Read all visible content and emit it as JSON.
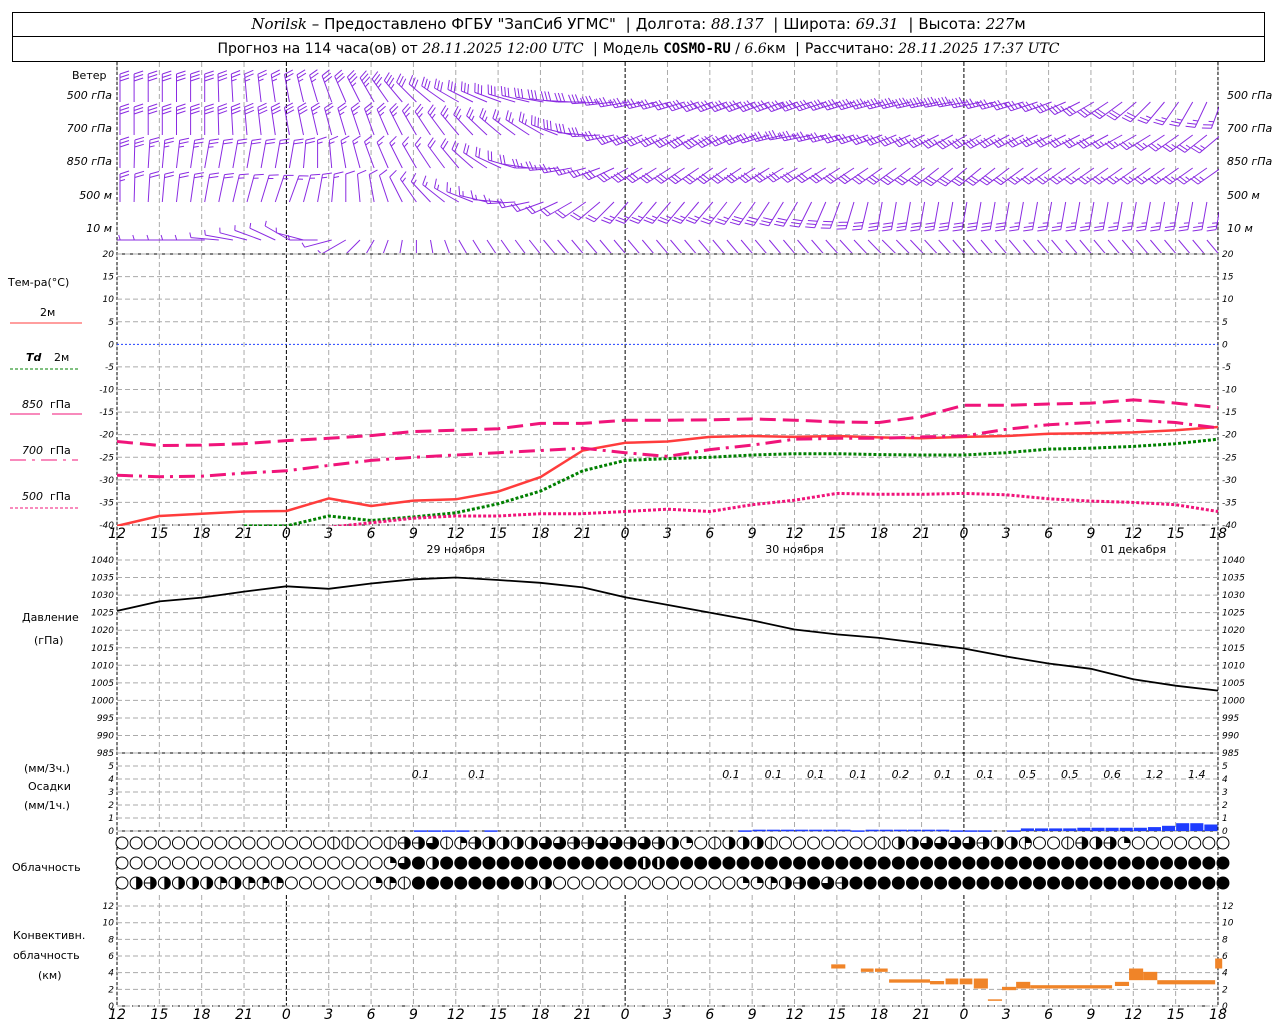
{
  "header": {
    "station": "Norilsk",
    "provider": " – Предоставлено ФГБУ \"ЗапСиб УГМС\"",
    "lon_label": "Долгота: ",
    "lon": "88.137",
    "lat_label": "Широта: ",
    "lat": "69.31",
    "alt_label": "Высота: ",
    "alt": "227",
    "alt_unit": "м",
    "forecast_label": "Прогноз на 114 часа(ов) от ",
    "forecast_time": "28.11.2025 12:00 UTC",
    "model_label": "Модель ",
    "model": "COSMO-RU",
    "model_sep": " / ",
    "resolution": "6.6",
    "resolution_unit": "км",
    "calc_label": "Рассчитано: ",
    "calc_time": "28.11.2025 17:37 UTC",
    "sep": "|"
  },
  "colors": {
    "t2m": "#ff3c3c",
    "td2m": "#008000",
    "upper": "#f0147a",
    "wind": "#8a2be2",
    "precip": "#1e3cff",
    "convective": "#f08428",
    "zero_line": "#2040ff"
  },
  "labels": {
    "wind": "Ветер",
    "temp": "Тем-ра(°C)",
    "t2m": "2м",
    "td": "Td",
    "td2m": "2м",
    "t850": "850",
    "t700": "700",
    "t500": "500",
    "hpa": "гПа",
    "pressure": "Давление",
    "pressure_unit": "(гПа)",
    "precip3": "(мм/3ч.)",
    "precip": "Осадки",
    "precip1": "(мм/1ч.)",
    "cloud": "Облачность",
    "conv1": "Конвективн.",
    "conv2": "облачность",
    "conv3": "(км)"
  },
  "x_tick_labels": [
    "12",
    "15",
    "18",
    "21",
    "0",
    "3",
    "6",
    "9",
    "12",
    "15",
    "18",
    "21",
    "0",
    "3",
    "6",
    "9",
    "12",
    "15",
    "18",
    "21",
    "0",
    "3",
    "6",
    "9",
    "12",
    "15",
    "18"
  ],
  "date_labels": [
    {
      "text": "29 ноября",
      "time": "29.11 12:00"
    },
    {
      "text": "30 ноября",
      "time": "30.11 12:00"
    },
    {
      "text": "01 декабря",
      "time": "01.12 12:00"
    }
  ],
  "series_start": "28.11 12:00",
  "wind": {
    "step_hours": 6,
    "levels": [
      {
        "label": "500 гПа",
        "dir": [
          0,
          0,
          350,
          330,
          300,
          280,
          260,
          250,
          250,
          255,
          260,
          250,
          230,
          200
        ],
        "speed_ms": [
          15,
          15,
          12,
          18,
          15,
          15,
          18,
          20,
          22,
          20,
          20,
          18,
          15,
          12
        ]
      },
      {
        "label": "700 гПа",
        "dir": [
          0,
          0,
          350,
          340,
          320,
          300,
          250,
          240,
          260,
          250,
          240,
          245,
          240,
          230
        ],
        "speed_ms": [
          15,
          15,
          15,
          12,
          12,
          14,
          18,
          20,
          18,
          17,
          18,
          16,
          14,
          12
        ]
      },
      {
        "label": "850 гПа",
        "dir": [
          0,
          10,
          10,
          340,
          320,
          270,
          240,
          235,
          240,
          235,
          230,
          235,
          235,
          235
        ],
        "speed_ms": [
          15,
          12,
          10,
          8,
          10,
          12,
          15,
          16,
          15,
          15,
          15,
          14,
          12,
          12
        ]
      },
      {
        "label": "500  м",
        "dir": [
          0,
          10,
          20,
          350,
          300,
          250,
          220,
          220,
          210,
          190,
          190,
          190,
          190,
          190
        ],
        "speed_ms": [
          12,
          10,
          8,
          6,
          8,
          10,
          12,
          14,
          15,
          15,
          15,
          14,
          14,
          14
        ]
      },
      {
        "label": "10   м",
        "dir": [
          270,
          270,
          300,
          210,
          150,
          140,
          140,
          140,
          140,
          135,
          140,
          140,
          140,
          140
        ],
        "speed_ms": [
          3,
          3,
          2,
          2,
          3,
          3,
          3,
          4,
          4,
          4,
          4,
          4,
          4,
          4
        ]
      }
    ]
  },
  "chart_data": [
    {
      "type": "line",
      "ylabel": "Тем-ра(°C)",
      "ylim": [
        -40,
        20
      ],
      "y_ticks": [
        20,
        15,
        10,
        5,
        0,
        -5,
        -10,
        -15,
        -20,
        -25,
        -30,
        -35,
        -40
      ],
      "step_hours": 3,
      "series": [
        {
          "name": "2м",
          "key": "t2m",
          "values": [
            -40.2,
            -38,
            -37.5,
            -37,
            -36.9,
            -34.1,
            -35.8,
            -34.6,
            -34.3,
            -32.6,
            -29.4,
            -23.5,
            -21.8,
            -21.5,
            -20.5,
            -20.3,
            -20.5,
            -20.3,
            -20.6,
            -20.8,
            -20.5,
            -20.3,
            -19.8,
            -19.7,
            -19.5,
            -19,
            -18.3
          ]
        },
        {
          "name": "Td 2м",
          "key": "td2m",
          "values": [
            null,
            null,
            null,
            -40.2,
            -40.2,
            -38,
            -39,
            -38.2,
            -37.3,
            -35.3,
            -32.5,
            -28,
            -25.7,
            -25.3,
            -25,
            -24.5,
            -24.2,
            -24.2,
            -24.4,
            -24.5,
            -24.5,
            -24,
            -23.2,
            -23,
            -22.6,
            -22,
            -21
          ]
        },
        {
          "name": "850 гПа",
          "key": "t850",
          "values": [
            -21.5,
            -22.4,
            -22.3,
            -22,
            -21.3,
            -20.8,
            -20.2,
            -19.3,
            -19,
            -18.7,
            -17.5,
            -17.5,
            -16.8,
            -16.8,
            -16.7,
            -16.5,
            -16.8,
            -17.2,
            -17.3,
            -16,
            -13.5,
            -13.5,
            -13.2,
            -13,
            -12.3,
            -13,
            -14
          ]
        },
        {
          "name": "700 гПа",
          "key": "t700",
          "values": [
            -29,
            -29.3,
            -29.2,
            -28.5,
            -28,
            -26.8,
            -25.7,
            -25,
            -24.5,
            -24,
            -23.5,
            -23,
            -24,
            -24.8,
            -23.3,
            -22.3,
            -21,
            -20.8,
            -20.8,
            -20.5,
            -20.3,
            -18.8,
            -17.8,
            -17.3,
            -16.8,
            -17.3,
            -18.5
          ]
        },
        {
          "name": "500 гПа",
          "key": "t500",
          "values": [
            null,
            null,
            null,
            null,
            null,
            -40.5,
            -39.5,
            -38.5,
            -38,
            -38,
            -37.5,
            -37.5,
            -37,
            -36.5,
            -37,
            -35.5,
            -34.5,
            -33,
            -33.2,
            -33.2,
            -33,
            -33.3,
            -34.2,
            -34.7,
            -35,
            -35.5,
            -37
          ]
        }
      ]
    },
    {
      "type": "line",
      "ylabel": "Давление (гПа)",
      "ylim": [
        985,
        1040
      ],
      "y_ticks": [
        1040,
        1035,
        1030,
        1025,
        1020,
        1015,
        1010,
        1005,
        1000,
        995,
        990,
        985
      ],
      "step_hours": 3,
      "values": [
        1025.5,
        1028.2,
        1029.3,
        1031,
        1032.5,
        1031.8,
        1033.3,
        1034.5,
        1035,
        1034.3,
        1033.5,
        1032.2,
        1029.4,
        1027.2,
        1025,
        1022.8,
        1020.2,
        1018.8,
        1017.8,
        1016.3,
        1014.8,
        1012.5,
        1010.5,
        1009,
        1006,
        1004.2,
        1002.8
      ]
    },
    {
      "type": "bar",
      "ylabel": "Осадки (мм/1ч.)",
      "ylim": [
        0,
        5
      ],
      "y_ticks": [
        5,
        4,
        3,
        2,
        1,
        0
      ],
      "step_hours": 1,
      "hourly_mm": [
        0,
        0,
        0,
        0,
        0,
        0,
        0,
        0,
        0,
        0,
        0,
        0,
        0,
        0,
        0,
        0,
        0,
        0,
        0,
        0,
        0,
        0.05,
        0.05,
        0.05,
        0.05,
        0,
        0.05,
        0,
        0,
        0,
        0,
        0,
        0,
        0,
        0,
        0,
        0,
        0,
        0,
        0,
        0,
        0,
        0,
        0,
        0.05,
        0.1,
        0.1,
        0.1,
        0.1,
        0.1,
        0.1,
        0.1,
        0.05,
        0.1,
        0.1,
        0.1,
        0.1,
        0.1,
        0.1,
        0.05,
        0.05,
        0.05,
        0,
        0.05,
        0.2,
        0.2,
        0.2,
        0.2,
        0.25,
        0.25,
        0.25,
        0.25,
        0.25,
        0.3,
        0.4,
        0.6,
        0.6,
        0.5
      ],
      "sums_3h": [
        {
          "time": "29.11 09:30",
          "value": "0.1"
        },
        {
          "time": "29.11 13:30",
          "value": "0.1"
        },
        {
          "time": "30.11 07:30",
          "value": "0.1"
        },
        {
          "time": "30.11 10:30",
          "value": "0.1"
        },
        {
          "time": "30.11 13:30",
          "value": "0.1"
        },
        {
          "time": "30.11 16:30",
          "value": "0.1"
        },
        {
          "time": "30.11 19:30",
          "value": "0.2"
        },
        {
          "time": "30.11 22:30",
          "value": "0.1"
        },
        {
          "time": "01.12 01:30",
          "value": "0.1"
        },
        {
          "time": "01.12 04:30",
          "value": "0.5"
        },
        {
          "time": "01.12 07:30",
          "value": "0.5"
        },
        {
          "time": "01.12 10:30",
          "value": "0.6"
        },
        {
          "time": "01.12 13:30",
          "value": "1.2"
        },
        {
          "time": "01.12 16:30",
          "value": "1.4"
        }
      ]
    },
    {
      "type": "table",
      "ylabel": "Облачность (октанты)",
      "step_hours": 1,
      "rows": [
        [
          0,
          0,
          0,
          0,
          0,
          0,
          0,
          0,
          0,
          0,
          0,
          0,
          0,
          0,
          0,
          1,
          1,
          0,
          0,
          1,
          5,
          5,
          6,
          1,
          3,
          5,
          4,
          4,
          4,
          4,
          6,
          6,
          5,
          5,
          6,
          6,
          5,
          6,
          5,
          4,
          2,
          0,
          1,
          4,
          4,
          4,
          1,
          0,
          0,
          0,
          0,
          0,
          0,
          0,
          1,
          4,
          4,
          6,
          6,
          6,
          6,
          5,
          4,
          4,
          3,
          0,
          0,
          1,
          5,
          4,
          5,
          2,
          0,
          0,
          0,
          0,
          0,
          0,
          0
        ],
        [
          0,
          0,
          0,
          0,
          0,
          0,
          0,
          0,
          0,
          0,
          0,
          0,
          0,
          0,
          0,
          0,
          0,
          0,
          0,
          2,
          6,
          8,
          4,
          8,
          8,
          8,
          8,
          8,
          8,
          8,
          8,
          8,
          8,
          8,
          8,
          8,
          8,
          7,
          7,
          8,
          8,
          8,
          8,
          8,
          8,
          8,
          8,
          8,
          8,
          8,
          8,
          8,
          8,
          8,
          8,
          8,
          8,
          8,
          8,
          8,
          8,
          8,
          8,
          8,
          8,
          8,
          8,
          8,
          8,
          8,
          8,
          8,
          8,
          8,
          8,
          8,
          8,
          8,
          8
        ],
        [
          0,
          4,
          5,
          4,
          4,
          4,
          4,
          3,
          4,
          3,
          3,
          3,
          0,
          0,
          0,
          0,
          0,
          0,
          2,
          3,
          1,
          8,
          8,
          8,
          8,
          8,
          8,
          8,
          8,
          4,
          4,
          0,
          0,
          0,
          0,
          0,
          0,
          0,
          0,
          0,
          0,
          0,
          0,
          0,
          2,
          2,
          3,
          4,
          5,
          8,
          6,
          5,
          8,
          8,
          8,
          8,
          8,
          8,
          8,
          8,
          8,
          8,
          8,
          8,
          8,
          8,
          8,
          8,
          8,
          8,
          8,
          8,
          8,
          8,
          8,
          8,
          8,
          8,
          8
        ]
      ]
    },
    {
      "type": "bar",
      "ylabel": "Конвективн. облачность (км)",
      "ylim": [
        0,
        13
      ],
      "y_ticks": [
        12,
        10,
        8,
        6,
        4,
        2,
        0
      ],
      "layers_km": [
        {
          "from": "30.11 14:36",
          "to": "30.11 15:36",
          "base": 4.5,
          "top": 5.0
        },
        {
          "from": "30.11 16:42",
          "to": "30.11 17:36",
          "base": 4.1,
          "top": 4.5
        },
        {
          "from": "30.11 17:42",
          "to": "30.11 18:36",
          "base": 4.1,
          "top": 4.5
        },
        {
          "from": "30.11 18:42",
          "to": "30.11 21:36",
          "base": 2.8,
          "top": 3.2
        },
        {
          "from": "30.11 21:36",
          "to": "30.11 22:36",
          "base": 2.6,
          "top": 3.0
        },
        {
          "from": "30.11 22:42",
          "to": "30.11 23:36",
          "base": 2.6,
          "top": 3.3
        },
        {
          "from": "30.11 23:42",
          "to": "01.12 00:36",
          "base": 2.6,
          "top": 3.3
        },
        {
          "from": "01.12 00:42",
          "to": "01.12 01:42",
          "base": 2.1,
          "top": 3.3
        },
        {
          "from": "01.12 01:42",
          "to": "01.12 02:42",
          "base": 0.7,
          "top": 0.8
        },
        {
          "from": "01.12 02:42",
          "to": "01.12 03:42",
          "base": 1.9,
          "top": 2.3
        },
        {
          "from": "01.12 03:42",
          "to": "01.12 04:42",
          "base": 2.1,
          "top": 2.9
        },
        {
          "from": "01.12 04:42",
          "to": "01.12 10:30",
          "base": 2.1,
          "top": 2.5
        },
        {
          "from": "01.12 10:42",
          "to": "01.12 11:42",
          "base": 2.4,
          "top": 2.9
        },
        {
          "from": "01.12 11:42",
          "to": "01.12 12:42",
          "base": 3.1,
          "top": 4.5
        },
        {
          "from": "01.12 12:42",
          "to": "01.12 13:42",
          "base": 3.1,
          "top": 4.1
        },
        {
          "from": "01.12 13:42",
          "to": "01.12 17:48",
          "base": 2.6,
          "top": 3.1
        },
        {
          "from": "01.12 17:48",
          "to": "01.12 18:18",
          "base": 4.5,
          "top": 5.7
        }
      ]
    }
  ]
}
